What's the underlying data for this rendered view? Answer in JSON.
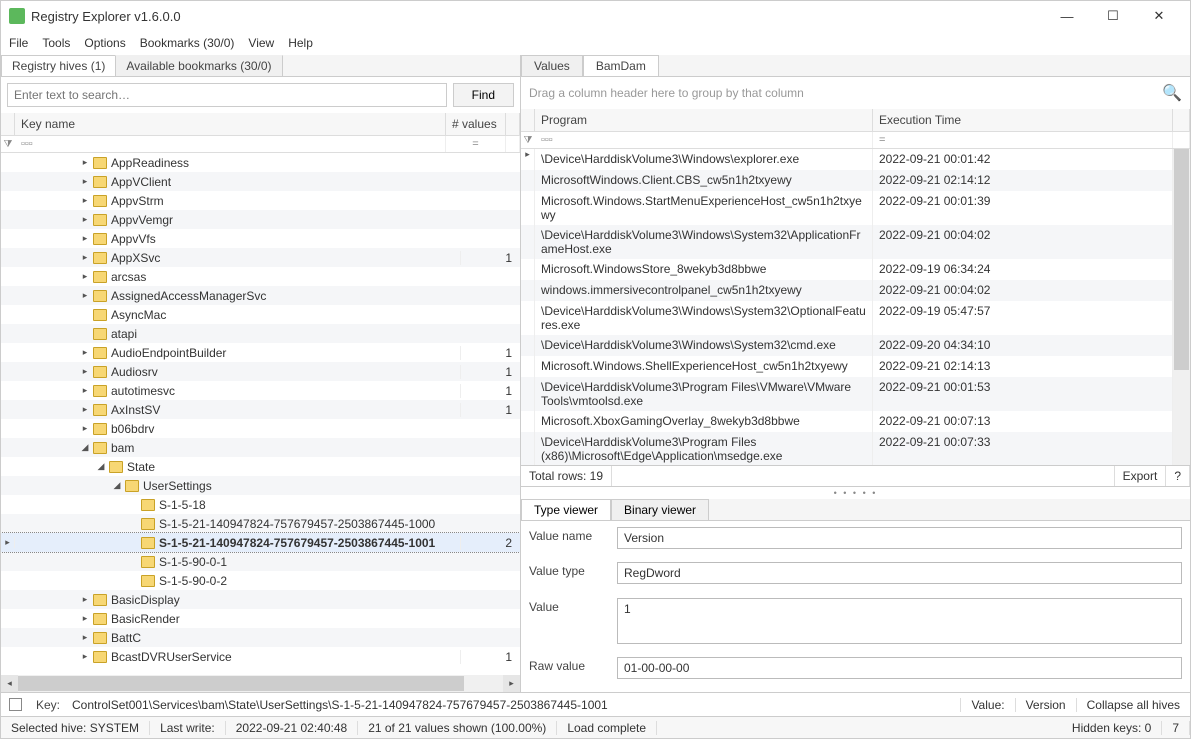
{
  "window": {
    "title": "Registry Explorer v1.6.0.0"
  },
  "menu": [
    "File",
    "Tools",
    "Options",
    "Bookmarks (30/0)",
    "View",
    "Help"
  ],
  "leftTabs": {
    "hives": "Registry hives (1)",
    "bookmarks": "Available bookmarks (30/0)"
  },
  "search": {
    "placeholder": "Enter text to search…",
    "button": "Find"
  },
  "treeHeader": {
    "name": "Key name",
    "values": "# values"
  },
  "filterSym": {
    "contains": "▫▫▫",
    "equals": "="
  },
  "tree": [
    {
      "depth": 4,
      "exp": "▸",
      "label": "AppReadiness",
      "values": ""
    },
    {
      "depth": 4,
      "exp": "▸",
      "label": "AppVClient",
      "values": ""
    },
    {
      "depth": 4,
      "exp": "▸",
      "label": "AppvStrm",
      "values": ""
    },
    {
      "depth": 4,
      "exp": "▸",
      "label": "AppvVemgr",
      "values": ""
    },
    {
      "depth": 4,
      "exp": "▸",
      "label": "AppvVfs",
      "values": ""
    },
    {
      "depth": 4,
      "exp": "▸",
      "label": "AppXSvc",
      "values": "1"
    },
    {
      "depth": 4,
      "exp": "▸",
      "label": "arcsas",
      "values": ""
    },
    {
      "depth": 4,
      "exp": "▸",
      "label": "AssignedAccessManagerSvc",
      "values": ""
    },
    {
      "depth": 4,
      "exp": "",
      "label": "AsyncMac",
      "values": ""
    },
    {
      "depth": 4,
      "exp": "",
      "label": "atapi",
      "values": ""
    },
    {
      "depth": 4,
      "exp": "▸",
      "label": "AudioEndpointBuilder",
      "values": "1"
    },
    {
      "depth": 4,
      "exp": "▸",
      "label": "Audiosrv",
      "values": "1"
    },
    {
      "depth": 4,
      "exp": "▸",
      "label": "autotimesvc",
      "values": "1"
    },
    {
      "depth": 4,
      "exp": "▸",
      "label": "AxInstSV",
      "values": "1"
    },
    {
      "depth": 4,
      "exp": "▸",
      "label": "b06bdrv",
      "values": ""
    },
    {
      "depth": 4,
      "exp": "◢",
      "label": "bam",
      "values": ""
    },
    {
      "depth": 5,
      "exp": "◢",
      "label": "State",
      "values": ""
    },
    {
      "depth": 6,
      "exp": "◢",
      "label": "UserSettings",
      "values": ""
    },
    {
      "depth": 7,
      "exp": "",
      "label": "S-1-5-18",
      "values": ""
    },
    {
      "depth": 7,
      "exp": "",
      "label": "S-1-5-21-140947824-757679457-2503867445-1000",
      "values": ""
    },
    {
      "depth": 7,
      "exp": "",
      "label": "S-1-5-21-140947824-757679457-2503867445-1001",
      "values": "2",
      "sel": true
    },
    {
      "depth": 7,
      "exp": "",
      "label": "S-1-5-90-0-1",
      "values": ""
    },
    {
      "depth": 7,
      "exp": "",
      "label": "S-1-5-90-0-2",
      "values": ""
    },
    {
      "depth": 4,
      "exp": "▸",
      "label": "BasicDisplay",
      "values": ""
    },
    {
      "depth": 4,
      "exp": "▸",
      "label": "BasicRender",
      "values": ""
    },
    {
      "depth": 4,
      "exp": "▸",
      "label": "BattC",
      "values": ""
    },
    {
      "depth": 4,
      "exp": "▸",
      "label": "BcastDVRUserService",
      "values": "1"
    }
  ],
  "rightTabs": {
    "values": "Values",
    "bamdam": "BamDam"
  },
  "groupHint": "Drag a column header here to group by that column",
  "dgHeader": {
    "program": "Program",
    "time": "Execution Time"
  },
  "rows": [
    {
      "p": "\\Device\\HarddiskVolume3\\Windows\\explorer.exe",
      "t": "2022-09-21 00:01:42"
    },
    {
      "p": "MicrosoftWindows.Client.CBS_cw5n1h2txyewy",
      "t": "2022-09-21 02:14:12"
    },
    {
      "p": "Microsoft.Windows.StartMenuExperienceHost_cw5n1h2txyewy",
      "t": "2022-09-21 00:01:39"
    },
    {
      "p": "\\Device\\HarddiskVolume3\\Windows\\System32\\ApplicationFrameHost.exe",
      "t": "2022-09-21 00:04:02"
    },
    {
      "p": "Microsoft.WindowsStore_8wekyb3d8bbwe",
      "t": "2022-09-19 06:34:24"
    },
    {
      "p": "windows.immersivecontrolpanel_cw5n1h2txyewy",
      "t": "2022-09-21 00:04:02"
    },
    {
      "p": "\\Device\\HarddiskVolume3\\Windows\\System32\\OptionalFeatures.exe",
      "t": "2022-09-19 05:47:57"
    },
    {
      "p": "\\Device\\HarddiskVolume3\\Windows\\System32\\cmd.exe",
      "t": "2022-09-20 04:34:10"
    },
    {
      "p": "Microsoft.Windows.ShellExperienceHost_cw5n1h2txyewy",
      "t": "2022-09-21 02:14:13"
    },
    {
      "p": "\\Device\\HarddiskVolume3\\Program Files\\VMware\\VMware Tools\\vmtoolsd.exe",
      "t": "2022-09-21 00:01:53"
    },
    {
      "p": "Microsoft.XboxGamingOverlay_8wekyb3d8bbwe",
      "t": "2022-09-21 00:07:13"
    },
    {
      "p": "\\Device\\HarddiskVolume3\\Program Files (x86)\\Microsoft\\Edge\\Application\\msedge.exe",
      "t": "2022-09-21 00:07:33"
    }
  ],
  "dgFooter": {
    "total": "Total rows: 19",
    "export": "Export",
    "q": "?"
  },
  "viewerTabs": {
    "type": "Type viewer",
    "bin": "Binary viewer"
  },
  "viewer": {
    "nameLbl": "Value name",
    "name": "Version",
    "typeLbl": "Value type",
    "type": "RegDword",
    "valueLbl": "Value",
    "value": "1",
    "rawLbl": "Raw value",
    "raw": "01-00-00-00"
  },
  "bottom": {
    "keyLbl": "Key:",
    "keyPath": "ControlSet001\\Services\\bam\\State\\UserSettings\\S-1-5-21-140947824-757679457-2503867445-1001",
    "valueLbl": "Value:",
    "valueName": "Version",
    "collapse": "Collapse all hives"
  },
  "status": {
    "hive": "Selected hive: SYSTEM",
    "lastwriteLbl": "Last write:",
    "lastwrite": "2022-09-21 02:40:48",
    "shown": "21 of 21 values shown (100.00%)",
    "load": "Load complete",
    "hidden": "Hidden keys: 0",
    "seven": "7"
  }
}
